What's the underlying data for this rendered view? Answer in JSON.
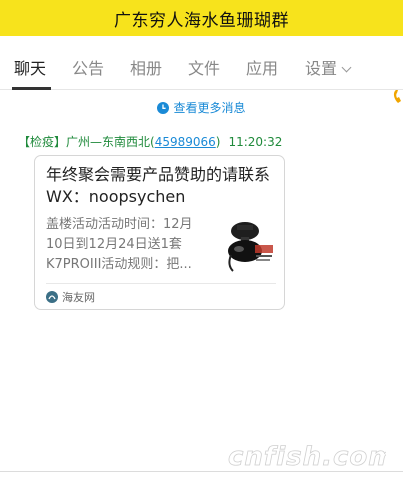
{
  "window": {
    "title": "广东穷人海水鱼珊瑚群"
  },
  "tabs": [
    {
      "label": "聊天",
      "active": true
    },
    {
      "label": "公告"
    },
    {
      "label": "相册"
    },
    {
      "label": "文件"
    },
    {
      "label": "应用"
    },
    {
      "label": "设置"
    }
  ],
  "history_link": {
    "label": "查看更多消息",
    "icon": "clock-icon"
  },
  "message": {
    "tag": "【检疫】广州—东南西北(",
    "qq_number": "45989066",
    "close_paren": ")",
    "time": "11:20:32"
  },
  "card": {
    "title": "年终聚会需要产品赞助的请联系WX：noopsychen",
    "description": "盖楼活动活动时间：12月10日到12月24日送1套K7PROIII活动规则：把...",
    "thumbnail_icon": "product-thumbnail",
    "source": "海友网",
    "source_icon": "haiyou-logo-icon"
  },
  "watermark": {
    "text": "cnfish.com"
  },
  "colors": {
    "title_bar": "#f7e31c",
    "link": "#1a8ad6",
    "sender": "#1f8a3b"
  }
}
